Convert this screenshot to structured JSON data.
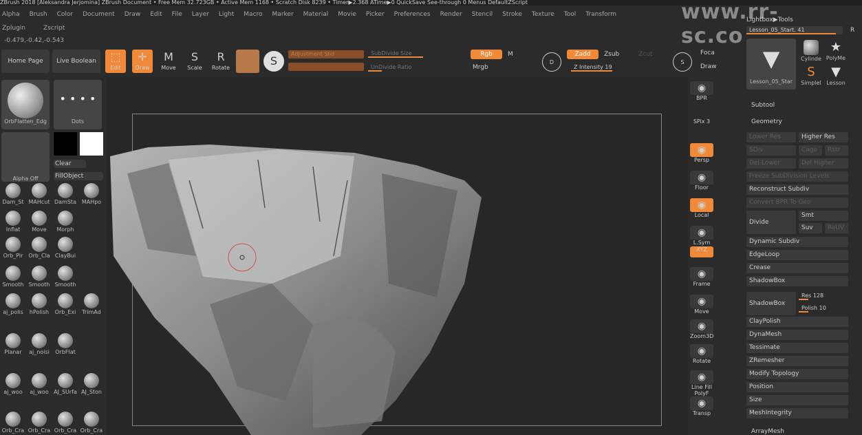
{
  "title_bar": "ZBrush 2018 [Aleksandra Jerjomina]   ZBrush Document   • Free Mem 32.723GB • Active Mem 1168 • Scratch Disk 8239 • Timer▶2.368 ATime▶0   QuickSave   See-through 0   Menus   DefaultZScript",
  "watermark": "www.rr-sc.com",
  "menus": [
    "Alpha",
    "Brush",
    "Color",
    "Document",
    "Draw",
    "Edit",
    "File",
    "Layer",
    "Light",
    "Macro",
    "Marker",
    "Material",
    "Movie",
    "Picker",
    "Preferences",
    "Render",
    "Stencil",
    "Stroke",
    "Texture",
    "Tool",
    "Transform"
  ],
  "menus2": [
    "Zplugin",
    "Zscript"
  ],
  "coords": "-0.479,-0.42,-0.543",
  "toolbar": {
    "home": "Home Page",
    "live_boolean": "Live Boolean",
    "edit": "Edit",
    "draw": "Draw",
    "move": "Move",
    "scale": "Scale",
    "rotate": "Rotate",
    "adjustment_slider": "Adjustment Slid",
    "subdivide_size": "SubDivide Size",
    "undivide_ratio": "UnDivide Ratio",
    "rgb": "Rgb",
    "m": "M",
    "mrgb": "Mrgb",
    "zadd": "Zadd",
    "zsub": "Zsub",
    "zcut": "Zcut",
    "z_intensity": "Z Intensity 19",
    "focal": "Foca",
    "draw2": "Draw",
    "d": "D",
    "s": "S"
  },
  "left": {
    "brush_main": "OrbFlatten_Edg",
    "stroke": "Dots",
    "alpha": "Alpha Off",
    "clear": "Clear",
    "fillobject": "FillObject",
    "brushes": [
      "Dam_St",
      "MAHcut",
      "DamSta",
      "MAHpo",
      "Inflat",
      "Move",
      "Morph",
      "Orb_Pir",
      "Orb_Cla",
      "ClayBui",
      "Smooth",
      "Smooth",
      "Smooth",
      "aj_polis",
      "hPolish",
      "Orb_Exi",
      "TrimAd",
      "Planar",
      "aj_noisi",
      "OrbFlat",
      "aj_woo",
      "aj_woo",
      "AJ_SUrfa",
      "AJ_Ston",
      "Orb_Cra",
      "Orb_Cra",
      "Orb_Cra",
      "Orb_Cra",
      "Orb_Cra"
    ]
  },
  "right_bar": [
    "BPR",
    "SPix 3",
    "Persp",
    "Floor",
    "Local",
    "L.Sym",
    "XYZ",
    "Frame",
    "Move",
    "Zoom3D",
    "Rotate",
    "Line Fill PolyF",
    "Transp"
  ],
  "tool_panel": {
    "lightbox_tools": "Lightbox▶Tools",
    "current_tool": "Lesson_05_Start. 41",
    "r": "R",
    "thumbs": [
      "Lesson_05_Star",
      "Cylinde",
      "PolyMe",
      "SimpleI",
      "Lesson"
    ],
    "subtool": "Subtool",
    "geometry": "Geometry",
    "lower_res": "Lower Res",
    "higher_res": "Higher Res",
    "sdiv": "SDiv",
    "cage": "Cage",
    "rstr": "Rstr",
    "del_lower": "Del Lower",
    "del_higher": "Del Higher",
    "freeze": "Freeze SubDivision Levels",
    "reconstruct": "Reconstruct Subdiv",
    "convert_bpr": "Convert BPR To Geo",
    "divide": "Divide",
    "smt": "Smt",
    "suv": "Suv",
    "reuv": "ReUV",
    "items": [
      "Dynamic Subdiv",
      "EdgeLoop",
      "Crease",
      "ShadowBox"
    ],
    "shadowbox": "ShadowBox",
    "res": "Res 128",
    "polish": "Polish 10",
    "items2": [
      "ClayPolish",
      "DynaMesh",
      "Tessimate",
      "ZRemesher",
      "Modify Topology",
      "Position",
      "Size",
      "MeshIntegrity"
    ],
    "arraymesh": "ArrayMesh"
  }
}
